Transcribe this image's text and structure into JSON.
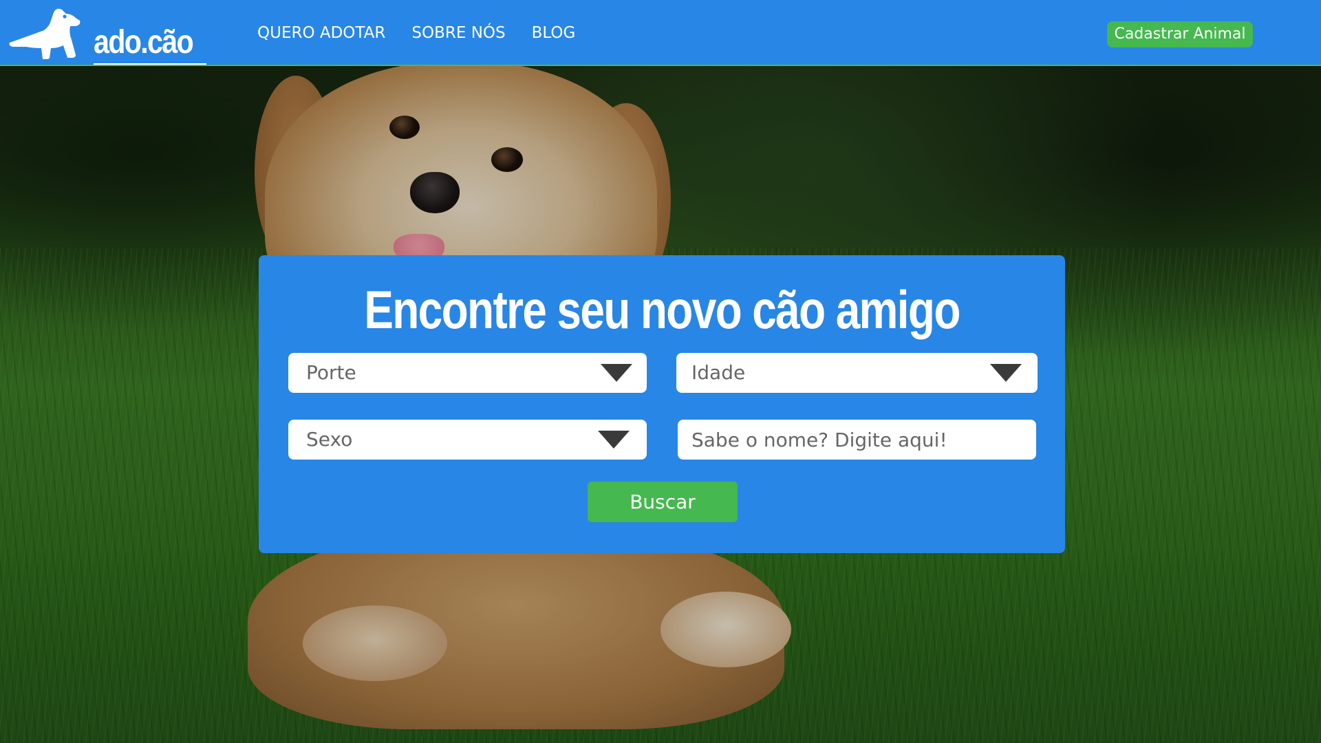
{
  "navbar": {
    "logo_text": "ado.cão",
    "links": [
      "QUERO ADOTAR",
      "SOBRE NÓS",
      "BLOG"
    ],
    "cta_label": "Cadastrar Animal"
  },
  "hero": {
    "image_icon": "puppy-photo"
  },
  "search": {
    "title": "Encontre seu novo cão amigo",
    "porte_label": "Porte",
    "idade_label": "Idade",
    "sexo_label": "Sexo",
    "name_placeholder": "Sabe o nome? Digite aqui!",
    "button_label": "Buscar"
  },
  "colors": {
    "primary_blue": "#2886e6",
    "accent_green": "#45b84f",
    "navbar_border": "#4cbf3e"
  }
}
